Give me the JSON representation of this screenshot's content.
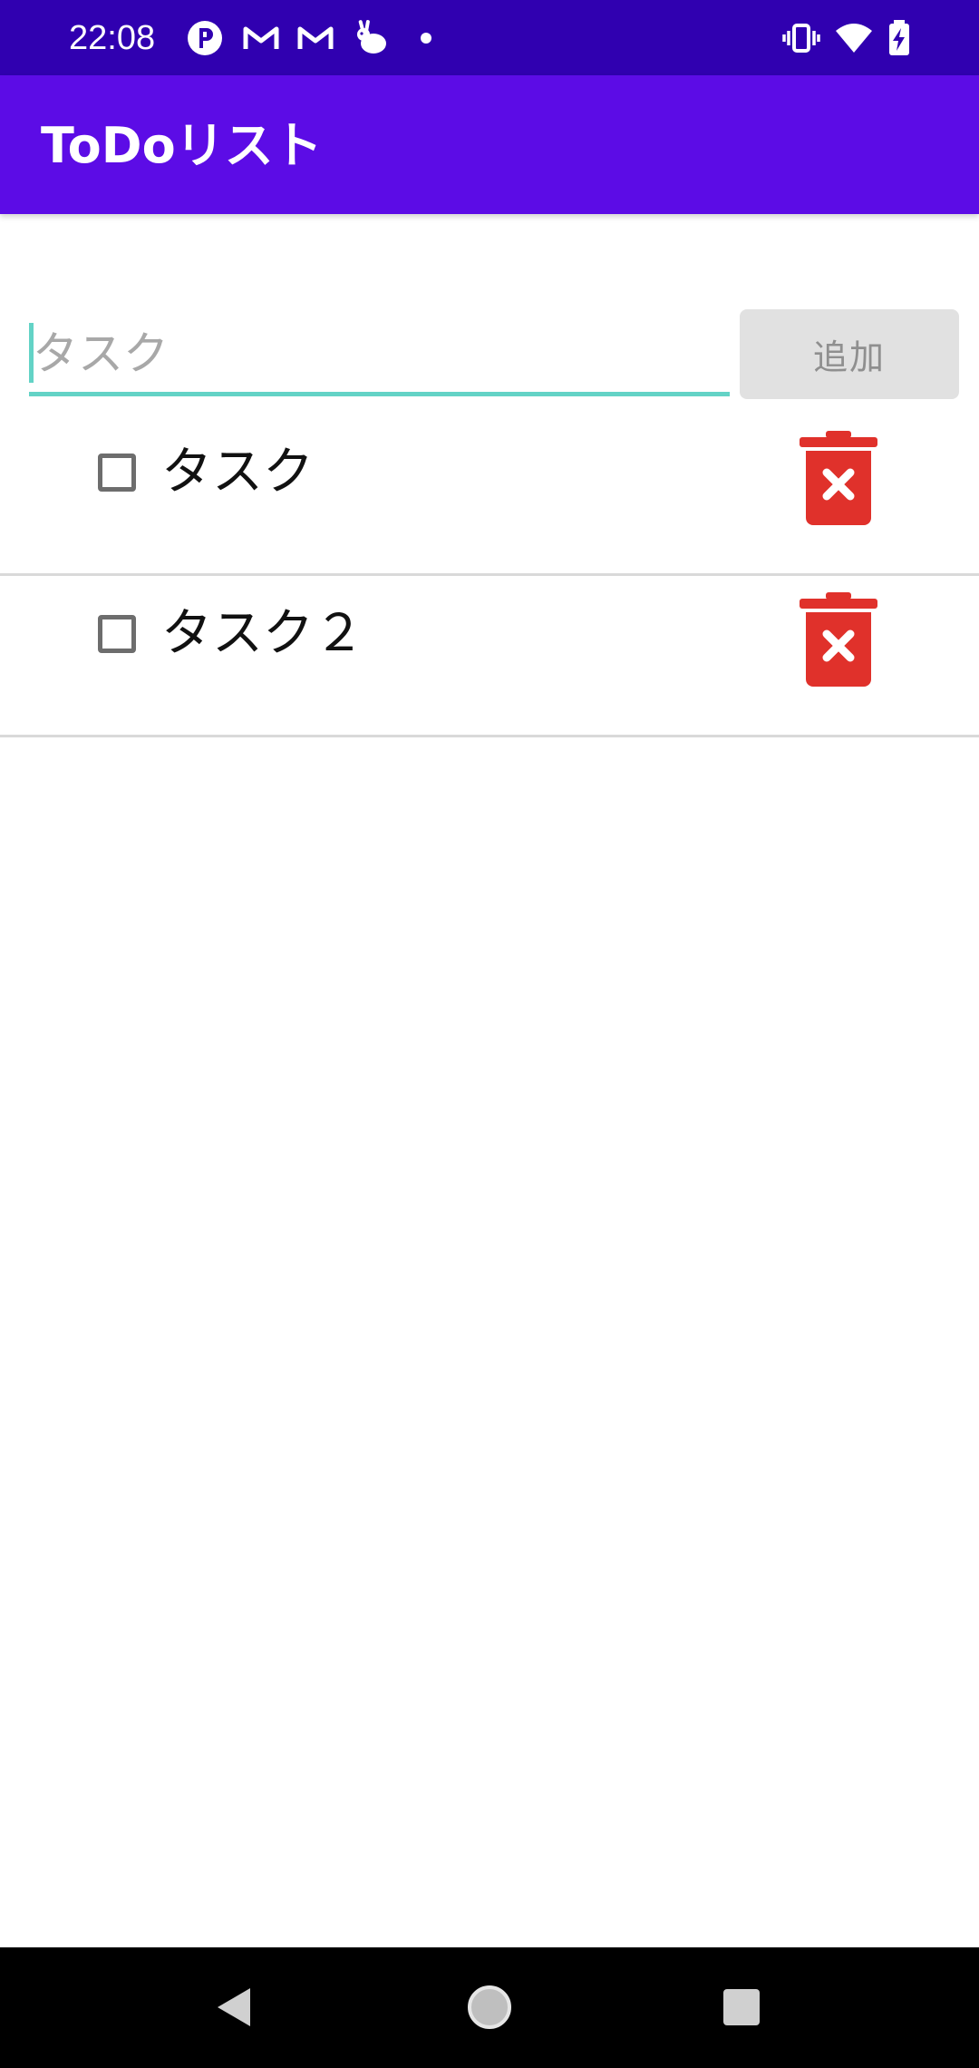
{
  "status_bar": {
    "time": "22:08",
    "notification_icons": [
      "p-app-icon",
      "gmail-icon",
      "gmail-icon",
      "rabbit-app-icon",
      "dot-icon"
    ],
    "system_icons": [
      "vibrate-icon",
      "wifi-icon",
      "battery-charging-icon"
    ]
  },
  "app_bar": {
    "title": "ToDoリスト",
    "color": "#5c0ce6"
  },
  "input": {
    "placeholder": "タスク",
    "value": "",
    "accent_color": "#63d3c6"
  },
  "add_button": {
    "label": "追加"
  },
  "tasks": [
    {
      "label": "タスク",
      "checked": false,
      "delete_icon": "trash-x-icon"
    },
    {
      "label": "タスク２",
      "checked": false,
      "delete_icon": "trash-x-icon"
    }
  ],
  "colors": {
    "status_bar": "#3000b0",
    "delete": "#e0312b"
  },
  "nav_bar": {
    "buttons": [
      "back-icon",
      "home-icon",
      "recents-icon"
    ]
  }
}
